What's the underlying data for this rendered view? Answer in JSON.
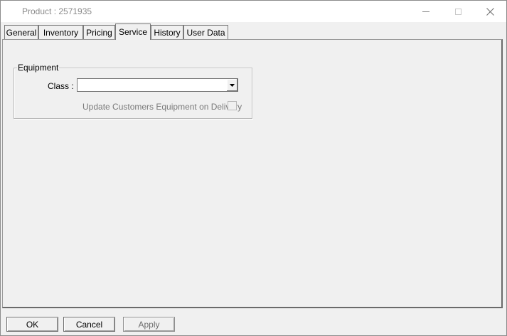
{
  "window": {
    "title": "Product : 2571935"
  },
  "tabs": [
    {
      "label": "General"
    },
    {
      "label": "Inventory"
    },
    {
      "label": "Pricing"
    },
    {
      "label": "Service",
      "active": true
    },
    {
      "label": "History"
    },
    {
      "label": "User Data"
    }
  ],
  "service": {
    "equipment_group": {
      "legend": "Equipment",
      "class_label": "Class :",
      "class_value": "",
      "update_label": "Update Customers Equipment on Delivery",
      "update_checked": false,
      "update_enabled": false
    }
  },
  "buttons": {
    "ok": "OK",
    "cancel": "Cancel",
    "apply": "Apply"
  },
  "colors": {
    "background": "#f0f0f0",
    "title_text": "#8a8a8a",
    "disabled_text": "#7a7a7a"
  }
}
